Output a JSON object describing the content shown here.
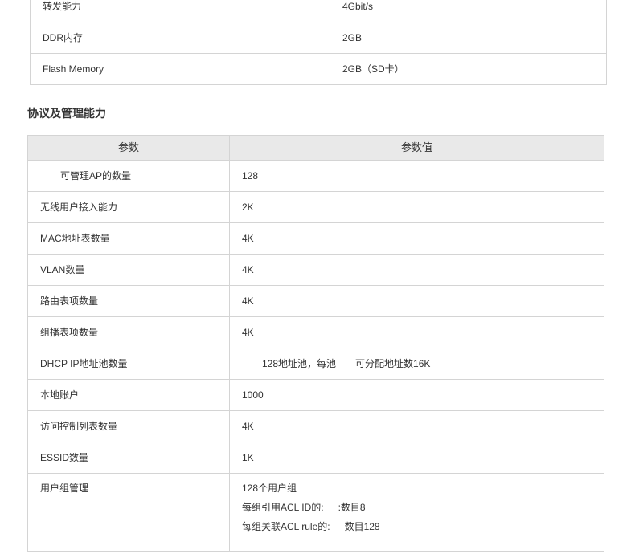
{
  "spec_top": {
    "rows": [
      {
        "param": "转发能力",
        "value": "4Gbit/s"
      },
      {
        "param": "DDR内存",
        "value": "2GB"
      },
      {
        "param": "Flash Memory",
        "value": "2GB（SD卡）"
      }
    ]
  },
  "section": {
    "title": "协议及管理能力"
  },
  "table": {
    "headers": [
      "参数",
      "参数值"
    ],
    "rows": [
      {
        "param": "可管理AP的数量",
        "value": "128"
      },
      {
        "param": "无线用户接入能力",
        "value": "2K"
      },
      {
        "param": "MAC地址表数量",
        "value": "4K"
      },
      {
        "param": "VLAN数量",
        "value": "4K"
      },
      {
        "param": "路由表项数量",
        "value": "4K"
      },
      {
        "param": "组播表项数量",
        "value": "4K"
      },
      {
        "param": "DHCP IP地址池数量",
        "value_a": "128地址池，每池",
        "value_b": "可分配地址数16K"
      },
      {
        "param": "本地账户",
        "value": "1000"
      },
      {
        "param": "访问控制列表数量",
        "value": "4K"
      },
      {
        "param": "ESSID数量",
        "value": "1K"
      },
      {
        "param": "用户组管理",
        "lines": [
          {
            "a": "128个用户组",
            "b": ""
          },
          {
            "a": "每组引用ACL ID的:",
            "b": ":数目8"
          },
          {
            "a": "每组关联ACL rule的:",
            "b": "数目128"
          }
        ]
      }
    ]
  }
}
